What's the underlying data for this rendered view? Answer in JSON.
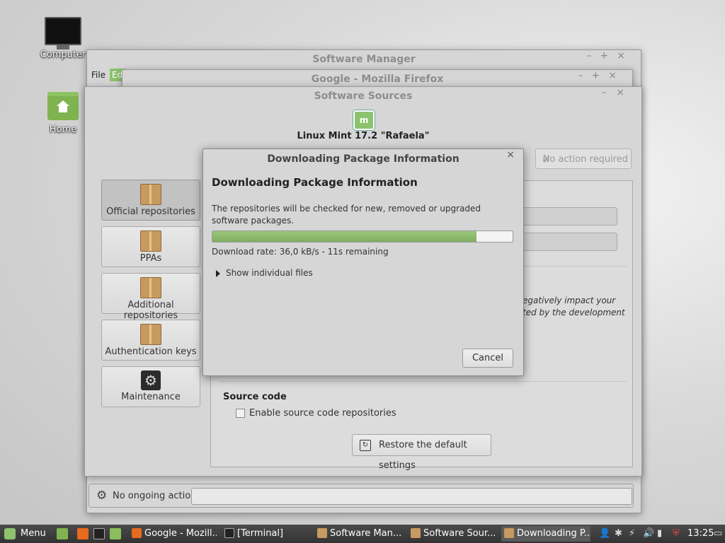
{
  "desktop": {
    "icons": [
      {
        "label": "Computer"
      },
      {
        "label": "Home"
      }
    ]
  },
  "windows": {
    "software_manager": {
      "title": "Software Manager",
      "menu_file": "File",
      "menu_edit": "Ed"
    },
    "firefox": {
      "title": "Google - Mozilla Firefox"
    },
    "software_sources": {
      "title": "Software Sources",
      "os_title": "Linux Mint 17.2 \"Rafaela\"",
      "no_action_label": "No action required",
      "sidebar": [
        {
          "label": "Official repositories",
          "icon": "package-icon",
          "active": true
        },
        {
          "label": "PPAs",
          "icon": "ppa-package-icon"
        },
        {
          "label": "Additional repositories",
          "icon": "add-package-icon"
        },
        {
          "label": "Authentication keys",
          "icon": "key-package-icon"
        },
        {
          "label": "Maintenance",
          "icon": "maintenance-gear-icon"
        }
      ],
      "partial_text_line1": "egatively impact your",
      "partial_text_line2": "ted by the development",
      "source_code_heading": "Source code",
      "source_code_checkbox": "Enable source code repositories",
      "restore_button": "Restore the default settings"
    }
  },
  "status_bar": {
    "text": "No ongoing actions"
  },
  "dialog": {
    "title": "Downloading Package Information",
    "heading": "Downloading Package Information",
    "message": "The repositories will be checked for new, removed or upgraded software packages.",
    "progress_fraction": 0.88,
    "rate_text": "Download rate: 36,0 kB/s - 11s remaining",
    "expander_label": "Show individual files",
    "cancel_label": "Cancel",
    "close_glyph": "×"
  },
  "taskbar": {
    "menu_label": "Menu",
    "tasks": [
      {
        "label": "Google - Mozill...",
        "icon": "firefox-icon"
      },
      {
        "label": "[Terminal]",
        "icon": "terminal-icon"
      },
      {
        "label": "Software Man...",
        "icon": "software-manager-icon"
      },
      {
        "label": "Software Sour...",
        "icon": "software-sources-icon"
      },
      {
        "label": "Downloading P...",
        "icon": "download-icon",
        "active": true
      }
    ],
    "clock": "13:25"
  },
  "colors": {
    "accent_green": "#8dc26f",
    "progress_green": "#7fae5e",
    "panel": "#333333"
  }
}
